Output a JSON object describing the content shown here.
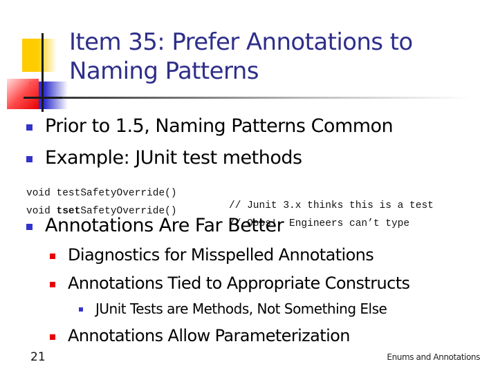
{
  "slide": {
    "title_line1": "Item 35: Prefer Annotations to",
    "title_line2": "Naming Patterns",
    "bullets_top": [
      {
        "text": "Prior to 1.5, Naming Patterns Common"
      },
      {
        "text": "Example: JUnit test methods"
      }
    ],
    "code": [
      {
        "prefix": "void ",
        "bold": "",
        "rest": "testSafetyOverride()",
        "comment": "// Junit 3.x thinks this is a test"
      },
      {
        "prefix": "void ",
        "bold": "tset",
        "rest": "SafetyOverride()",
        "comment": "// Oops!  Engineers can’t type"
      }
    ],
    "main_bullet": "Annotations Are Far Better",
    "sub_bullets": [
      {
        "text": "Diagnostics for Misspelled Annotations"
      },
      {
        "text": "Annotations Tied to Appropriate Constructs"
      },
      {
        "text": "Annotations Allow Parameterization"
      }
    ],
    "sub_sub_bullets": [
      {
        "text": "JUnit Tests are Methods, Not Something Else"
      }
    ],
    "slide_number": "21",
    "footer": "Enums and Annotations"
  },
  "colors": {
    "title": "#2e2e8a",
    "bullet_level1": "#3333cc",
    "bullet_level2": "#e60000",
    "bullet_level3": "#3333cc"
  }
}
